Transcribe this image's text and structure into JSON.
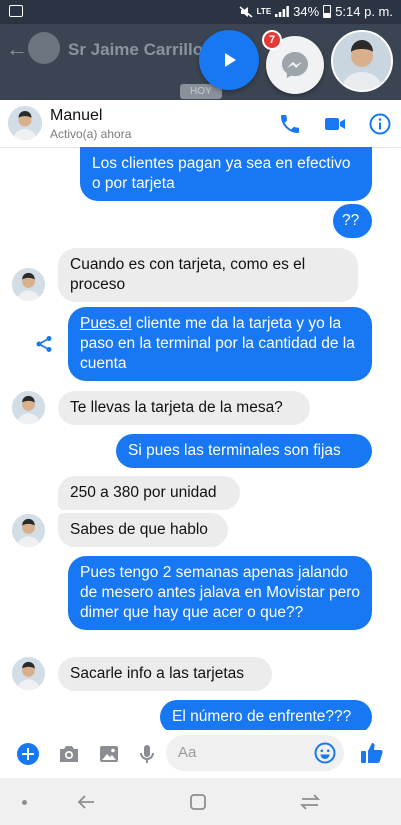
{
  "status_bar": {
    "network": "LTE",
    "battery": "34%",
    "time": "5:14 p. m."
  },
  "background_chat": {
    "title": "Sr Jaime Carrillo",
    "date_chip": "HOY"
  },
  "chat_heads": {
    "unread_count": "7"
  },
  "chat": {
    "contact_name": "Manuel",
    "contact_status": "Activo(a) ahora",
    "composer_placeholder": "Aa",
    "messages": [
      {
        "from": "me",
        "text": "Los clientes pagan ya sea en efectivo o por tarjeta"
      },
      {
        "from": "me",
        "text": "??"
      },
      {
        "from": "them",
        "text": "Cuando es con tarjeta, como es el proceso"
      },
      {
        "from": "me",
        "link": "Pues.el",
        "text": " cliente me da la tarjeta y yo la paso en la terminal por la cantidad de la cuenta"
      },
      {
        "from": "them",
        "text": "Te llevas la tarjeta de la mesa?"
      },
      {
        "from": "me",
        "text": "Si pues las terminales son fijas"
      },
      {
        "from": "them",
        "text": "250 a 380 por unidad"
      },
      {
        "from": "them",
        "text": "Sabes de que hablo"
      },
      {
        "from": "me",
        "text": "Pues tengo 2 semanas apenas jalando de mesero antes jalava en Movistar pero dimer que hay que acer o que??"
      },
      {
        "from": "them",
        "text": "Sacarle info a las tarjetas"
      },
      {
        "from": "me",
        "text": "El número de enfrente???"
      }
    ]
  },
  "colors": {
    "accent": "#1877f2",
    "incoming_bubble": "#ececec",
    "badge": "#e53935"
  }
}
